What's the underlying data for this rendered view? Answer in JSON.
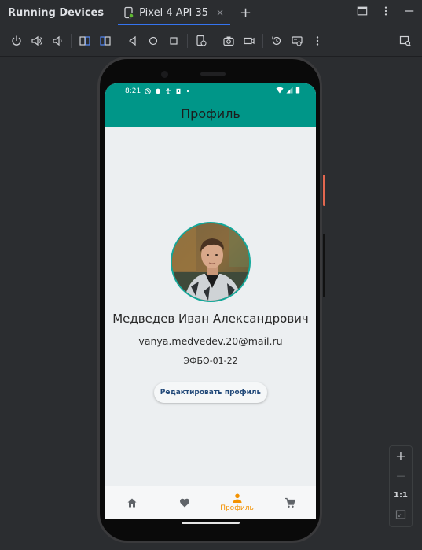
{
  "ide": {
    "panel_title": "Running Devices",
    "tab_label": "Pixel 4 API 35",
    "tab_close": "×",
    "add_tab": "+"
  },
  "phone": {
    "status": {
      "time": "8:21"
    },
    "app_title": "Профиль",
    "profile": {
      "name": "Медведев Иван Александрович",
      "email": "vanya.medvedev.20@mail.ru",
      "group": "ЭФБО-01-22",
      "edit_button": "Редактировать профиль"
    },
    "bottom_nav": {
      "items": [
        {
          "icon": "home-icon",
          "label": "",
          "active": false
        },
        {
          "icon": "heart-icon",
          "label": "",
          "active": false
        },
        {
          "icon": "person-icon",
          "label": "Профиль",
          "active": true
        },
        {
          "icon": "cart-icon",
          "label": "",
          "active": false
        }
      ]
    }
  },
  "zoom": {
    "plus": "+",
    "minus": "—",
    "one_to_one": "1:1"
  },
  "colors": {
    "app_bar": "#009688",
    "active_nav": "#f39200",
    "screen_bg": "#eceff1",
    "ide_bg": "#2b2d30",
    "tab_underline": "#3574f0"
  }
}
